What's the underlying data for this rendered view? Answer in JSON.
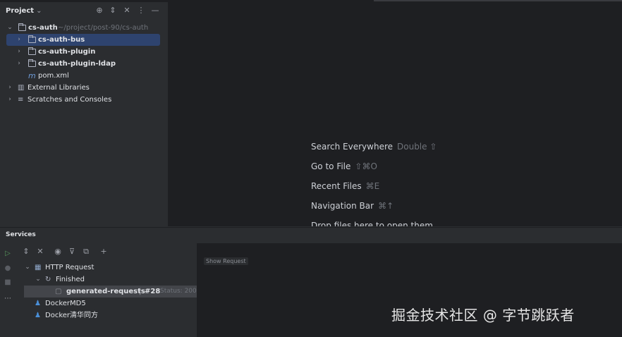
{
  "project": {
    "title": "Project",
    "tree": [
      {
        "name": "cs-auth",
        "path": "~/project/post-90/cs-auth"
      },
      {
        "name": "cs-auth-bus"
      },
      {
        "name": "cs-auth-plugin"
      },
      {
        "name": "cs-auth-plugin-ldap"
      },
      {
        "name": "pom.xml"
      },
      {
        "name": "External Libraries"
      },
      {
        "name": "Scratches and Consoles"
      }
    ]
  },
  "editor": {
    "hints": [
      {
        "label": "Search Everywhere",
        "shortcut": "Double ⇧"
      },
      {
        "label": "Go to File",
        "shortcut": "⇧⌘O"
      },
      {
        "label": "Recent Files",
        "shortcut": "⌘E"
      },
      {
        "label": "Navigation Bar",
        "shortcut": "⌘↑"
      },
      {
        "label": "Drop files here to open them",
        "shortcut": ""
      }
    ]
  },
  "services": {
    "title": "Services",
    "tree": [
      {
        "label": "HTTP Request"
      },
      {
        "label": "Finished"
      },
      {
        "label": "generated-requests",
        "run": "#28",
        "status": "Status: 200"
      },
      {
        "label": "DockerMD5"
      },
      {
        "label": "Docker清华同方"
      }
    ],
    "show_request": "Show Request"
  },
  "watermark": "掘金技术社区 @ 字节跳跃者"
}
